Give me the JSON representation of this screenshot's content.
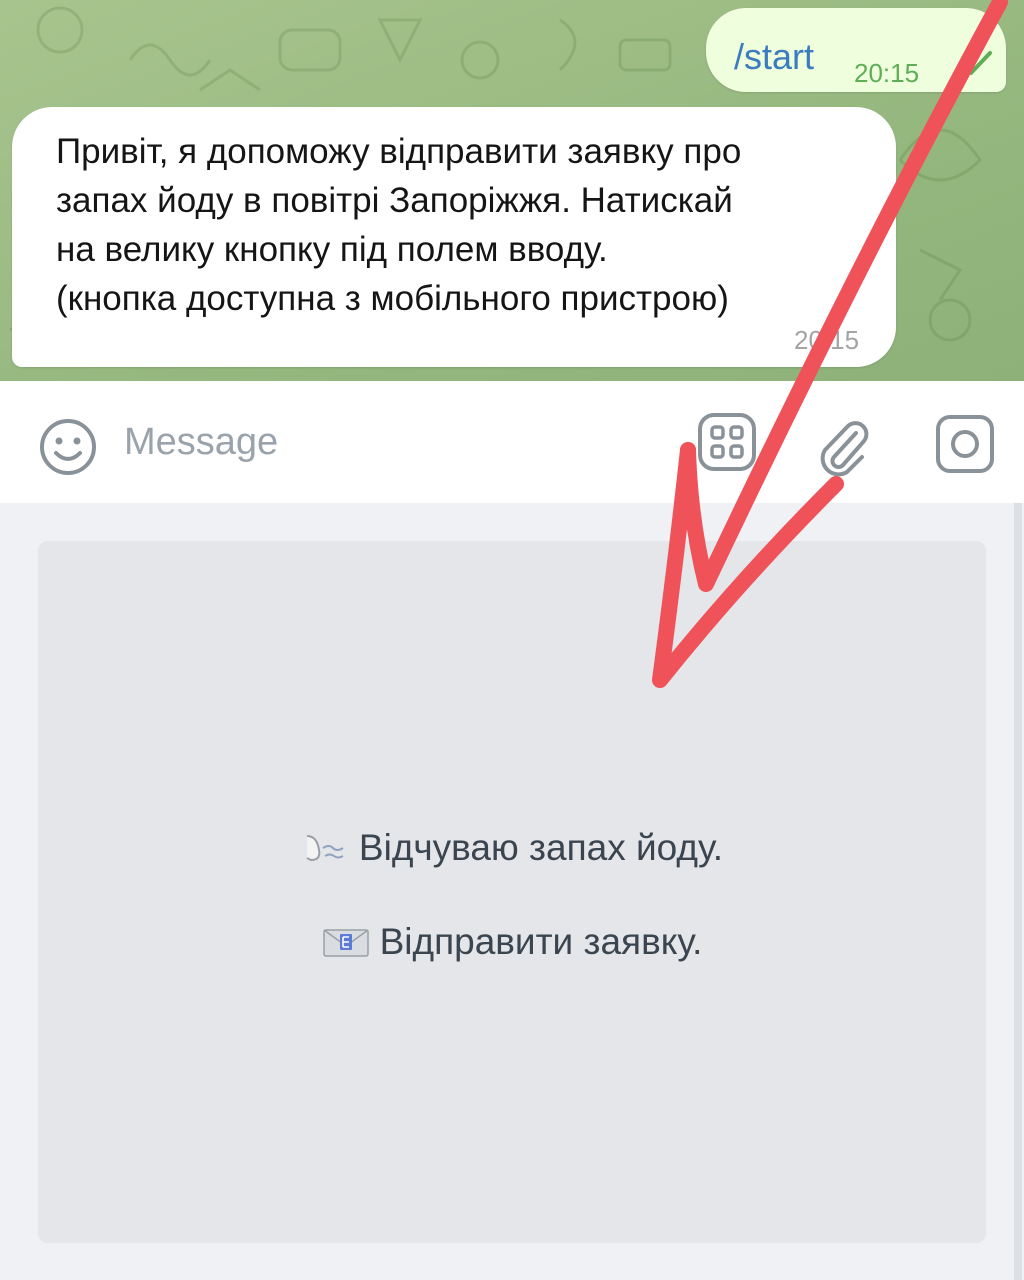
{
  "chat": {
    "outgoing": {
      "text": "/start",
      "time": "20:15"
    },
    "incoming": {
      "text": "Привіт, я допоможу відправити заявку про\nзапах йоду в повітрі Запоріжжя. Натискай\nна велику кнопку під полем вводу.\n(кнопка доступна з мобільного пристрою)",
      "time": "20:15"
    }
  },
  "input": {
    "placeholder": "Message",
    "value": "",
    "icons": [
      "emoji-icon",
      "bot-keyboard-icon",
      "paperclip-icon",
      "camera-icon"
    ]
  },
  "keyboard": {
    "buttons": [
      {
        "label": "Відчуваю запах йоду.",
        "icon": "nose-sniffing-icon"
      },
      {
        "label": "Відправити заявку.",
        "icon": "envelope-icon"
      }
    ]
  },
  "colors": {
    "chat_background": "#9dbd85",
    "outgoing_bubble": "#effedd",
    "link_blue": "#3a7cbf",
    "outgoing_time": "#5fae55",
    "annotation_arrow": "#f0525a"
  }
}
